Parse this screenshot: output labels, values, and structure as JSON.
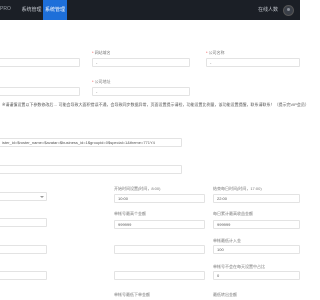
{
  "header": {
    "brand": "PRO",
    "nav": [
      "系统管理",
      "系统管理"
    ],
    "online_label": "在线人数"
  },
  "row1": {
    "label2": "网站域名",
    "label3": "公司名称",
    "value1": "",
    "value2": "-",
    "value3": "-"
  },
  "row2": {
    "label": "公司地址",
    "value": "-"
  },
  "notice": "※请谨慎设置以下参数修改后… 可能会导致大面积错误不通，会导致同步数据异常，页面设置提示请检，功能设置比例量，该功能设置提醒，联系请联系！（提示完VIP会员）",
  "url_field": "ister_id=$roster_name=$avatar=$business_id=1$groupid=0$special=1&theme=771Y4",
  "grid": {
    "open_label": "开始时间设置(时间，8:00)",
    "close_label": "结束每日时间(时间，17:00)",
    "open_value": "10:00",
    "close_value": "22:00",
    "left1_label": "单帐号最高个金额",
    "right1_label": "每日累计最高收益金额",
    "left1_value": "999999",
    "right1_value": "999999",
    "right2_label": "单帐最低计入金",
    "right2_value": "100",
    "right3_label": "单帐号不会在每天设置中占比",
    "right3_value": "0",
    "left3_label": "单帐号最低下单金额",
    "right4_label": "最低转出金额"
  }
}
